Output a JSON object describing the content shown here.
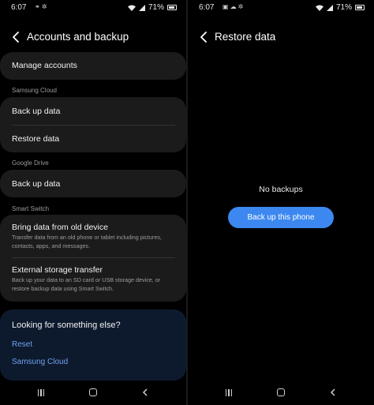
{
  "colors": {
    "background": "#000000",
    "card": "#1b1b1b",
    "help_card": "#0d1a2e",
    "link": "#6fa0ee",
    "primary_button": "#3c88f0"
  },
  "left_screen": {
    "status": {
      "time": "6:07",
      "battery": "71%",
      "notification_icons": [
        "link-icon",
        "settings-icon"
      ]
    },
    "header": {
      "title": "Accounts and backup"
    },
    "manage_accounts": "Manage accounts",
    "samsung_cloud": {
      "section_label": "Samsung Cloud",
      "items": [
        "Back up data",
        "Restore data"
      ]
    },
    "google_drive": {
      "section_label": "Google Drive",
      "items": [
        "Back up data"
      ]
    },
    "smart_switch": {
      "section_label": "Smart Switch",
      "bring_data": {
        "title": "Bring data from old device",
        "description": "Transfer data from an old phone or tablet including pictures, contacts, apps, and messages."
      },
      "external_storage": {
        "title": "External storage transfer",
        "description": "Back up your data to an SD card or USB storage device, or restore backup data using Smart Switch."
      }
    },
    "help": {
      "question": "Looking for something else?",
      "links": [
        "Reset",
        "Samsung Cloud"
      ]
    }
  },
  "right_screen": {
    "status": {
      "time": "6:07",
      "battery": "71%",
      "notification_icons": [
        "image-icon",
        "cloud-icon",
        "settings-icon"
      ]
    },
    "header": {
      "title": "Restore data"
    },
    "empty_message": "No backups",
    "backup_button": "Back up this phone"
  },
  "navbar": {
    "icons": [
      "recents-icon",
      "home-icon",
      "back-icon"
    ]
  }
}
